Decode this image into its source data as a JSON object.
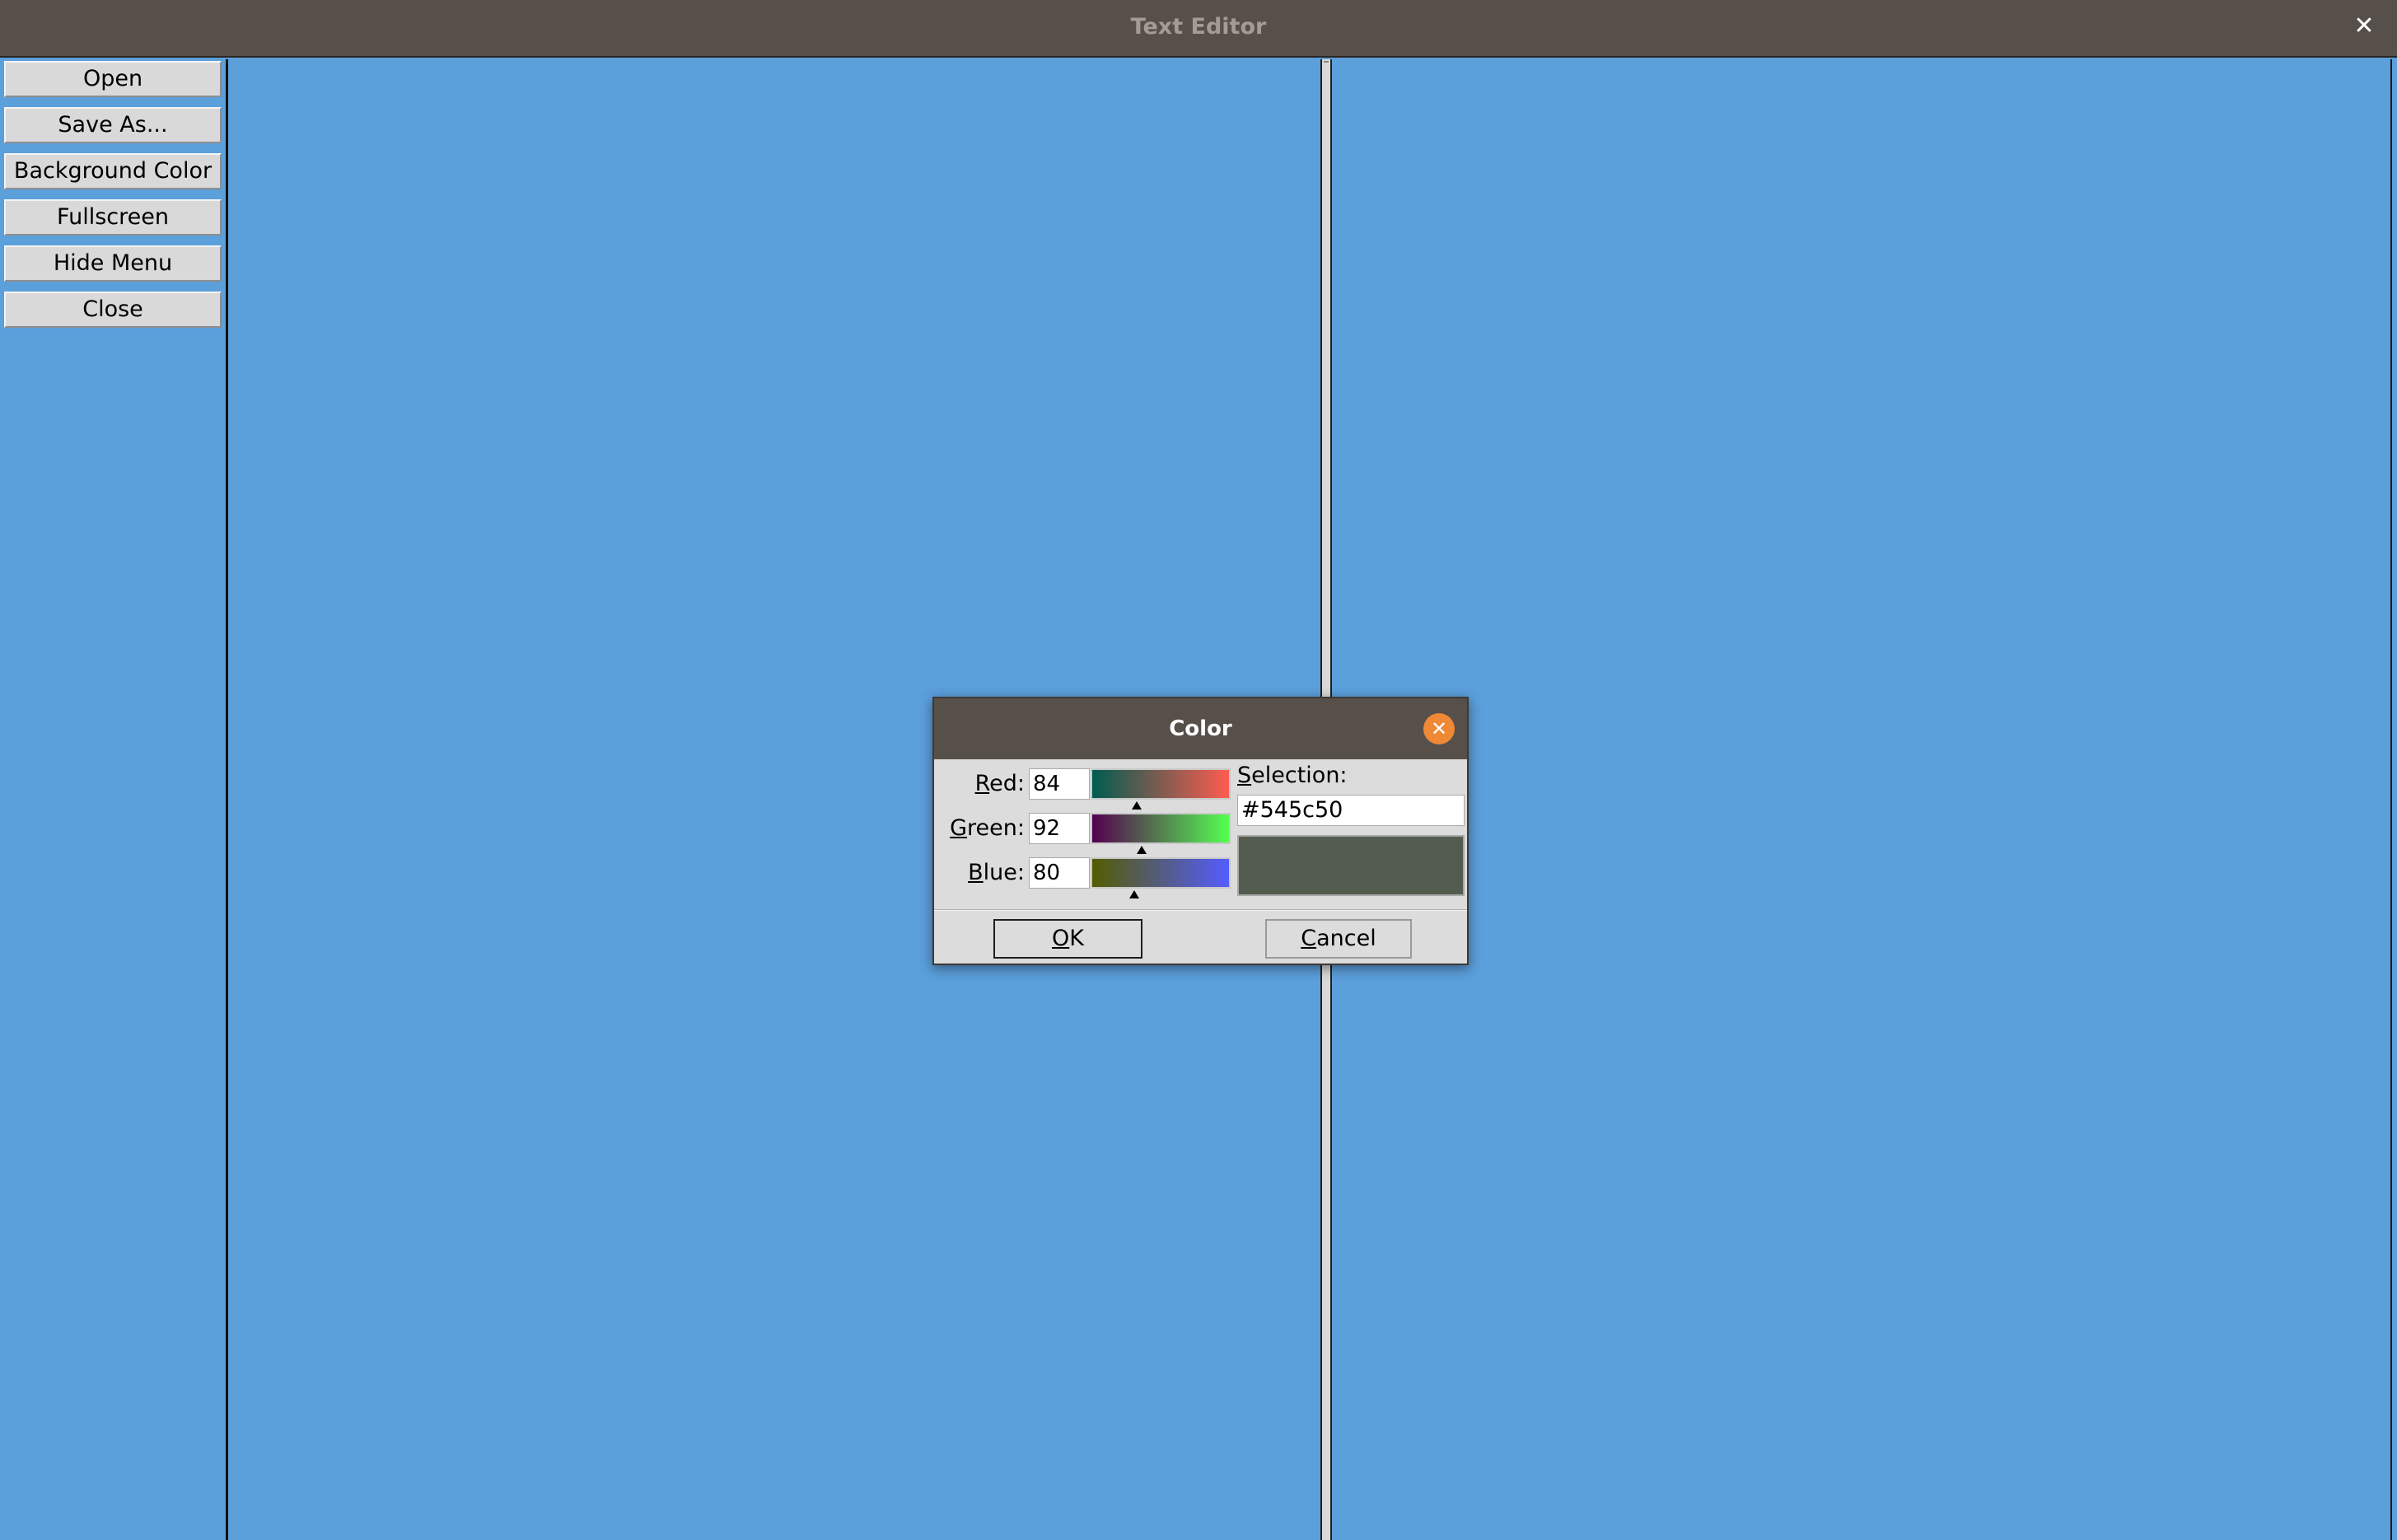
{
  "window": {
    "title": "Text Editor",
    "close_glyph": "✕",
    "close_icon": "close-icon"
  },
  "menu": {
    "items": [
      {
        "label": "Open"
      },
      {
        "label": "Save As..."
      },
      {
        "label": "Background Color"
      },
      {
        "label": "Fullscreen"
      },
      {
        "label": "Hide Menu"
      },
      {
        "label": "Close"
      }
    ]
  },
  "editor": {
    "background_color": "#5b9fdb",
    "left_text": "",
    "right_text": ""
  },
  "color_dialog": {
    "title": "Color",
    "close_glyph": "✕",
    "close_icon": "close-circle-icon",
    "red": {
      "label_first": "R",
      "label_rest": "ed:",
      "value": "84"
    },
    "green": {
      "label_first": "G",
      "label_rest": "reen:",
      "value": "92"
    },
    "blue": {
      "label_first": "B",
      "label_rest": "lue:",
      "value": "80"
    },
    "selection": {
      "label_first": "S",
      "label_rest": "election:",
      "value": "#545c50"
    },
    "swatch_color": "#545c50",
    "ok": {
      "label_first": "O",
      "label_rest": "K"
    },
    "cancel": {
      "label_first": "C",
      "label_rest": "ancel"
    }
  }
}
